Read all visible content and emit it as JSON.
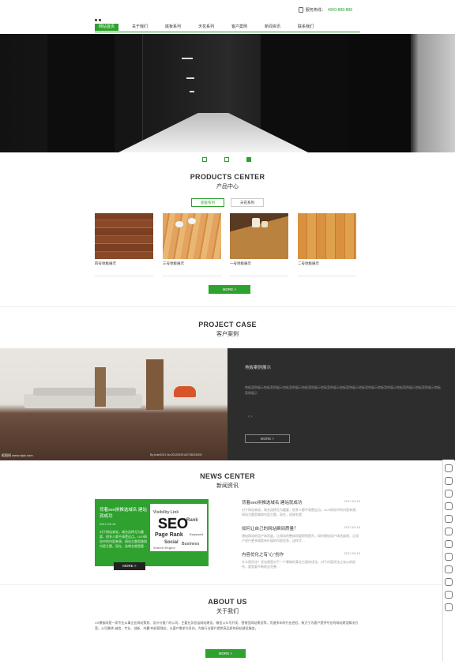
{
  "header": {
    "hotline_label": "服务热线：",
    "hotline_number": "4000-888-888",
    "nav": [
      "网站首页",
      "关于我们",
      "底板系列",
      "天花系列",
      "客户案例",
      "新闻资讯",
      "联系我们"
    ]
  },
  "products": {
    "title_en": "PRODUCTS CENTER",
    "title_cn": "产品中心",
    "tabs": [
      "底板系列",
      "天花系列"
    ],
    "items": [
      {
        "caption": "四号地板展示"
      },
      {
        "caption": "三号地板展示"
      },
      {
        "caption": "一号地板展示"
      },
      {
        "caption": "二号地板展示"
      }
    ],
    "more": "MORE  >"
  },
  "cases": {
    "title_en": "PROJECT CASE",
    "title_cn": "客户案例",
    "panel_title": "地板案例展示",
    "panel_desc": "地板案例展示地板案例展示地板案例展示地板案例展示地板案例展示地板案例展示地板案例展示地板案例展示地板案例展示地板案例展示地板案例展示",
    "arrows": "‹   ›",
    "more": "MORE  >",
    "watermark_left": "昵图网 www.nipic.com",
    "watermark_right": "By:fodel2011 No:20120519142738225000"
  },
  "news": {
    "title_en": "NEWS CENTER",
    "title_cn": "新闻资讯",
    "featured": {
      "title": "背着seo拼推选域名 建站就成功",
      "date": "2017-03-16",
      "summary": "对于网站来说，域名选择尤为重要，很多人都不清楚这点。ULR网站中的内容来源，网站主题思路和内容主题，现在，选域名就是要…",
      "more": "MORE  >"
    },
    "items": [
      {
        "title": "背着seo拼推选域名 建站就成功",
        "date": "2017-03-16",
        "summary": "对于网站来说，域名选择尤为重要，很多人都不清楚这点。ULR网站中的内容来源，网站主题思路和内容主题，现在，选域名就…"
      },
      {
        "title": "如何让自己的网站瞬间质量？",
        "date": "2017-03-16",
        "summary": "增加网站的用户体验度，让网站的整体质量得到提升，如何增加用户体验度呢，让用户进行更多搜索有价值的内容信息，这样才…"
      },
      {
        "title": "内容优化之有“心”创作",
        "date": "2017-03-16",
        "summary": "什么是优化？优化就是对于一个事物的某些方面的优化，对于内容优化之有心的创作，就是要不断地去完善…"
      }
    ]
  },
  "about": {
    "title_en": "ABOUT US",
    "title_cn": "关于我们",
    "text": "XX模板网是一家专业从事企业网站策划、设计与推广的公司，主要业务包括网站建设、微信公众号开发、营销型网站建设等，凭借多年的行业经验，致力于为客户提供专业的网站建设解决方案。公司秉承“诚信、专业、创新、共赢”的经营理念，以客户需求为导向，为各行业客户提供高品质的网站建设服务。",
    "more": "MORE  >"
  }
}
